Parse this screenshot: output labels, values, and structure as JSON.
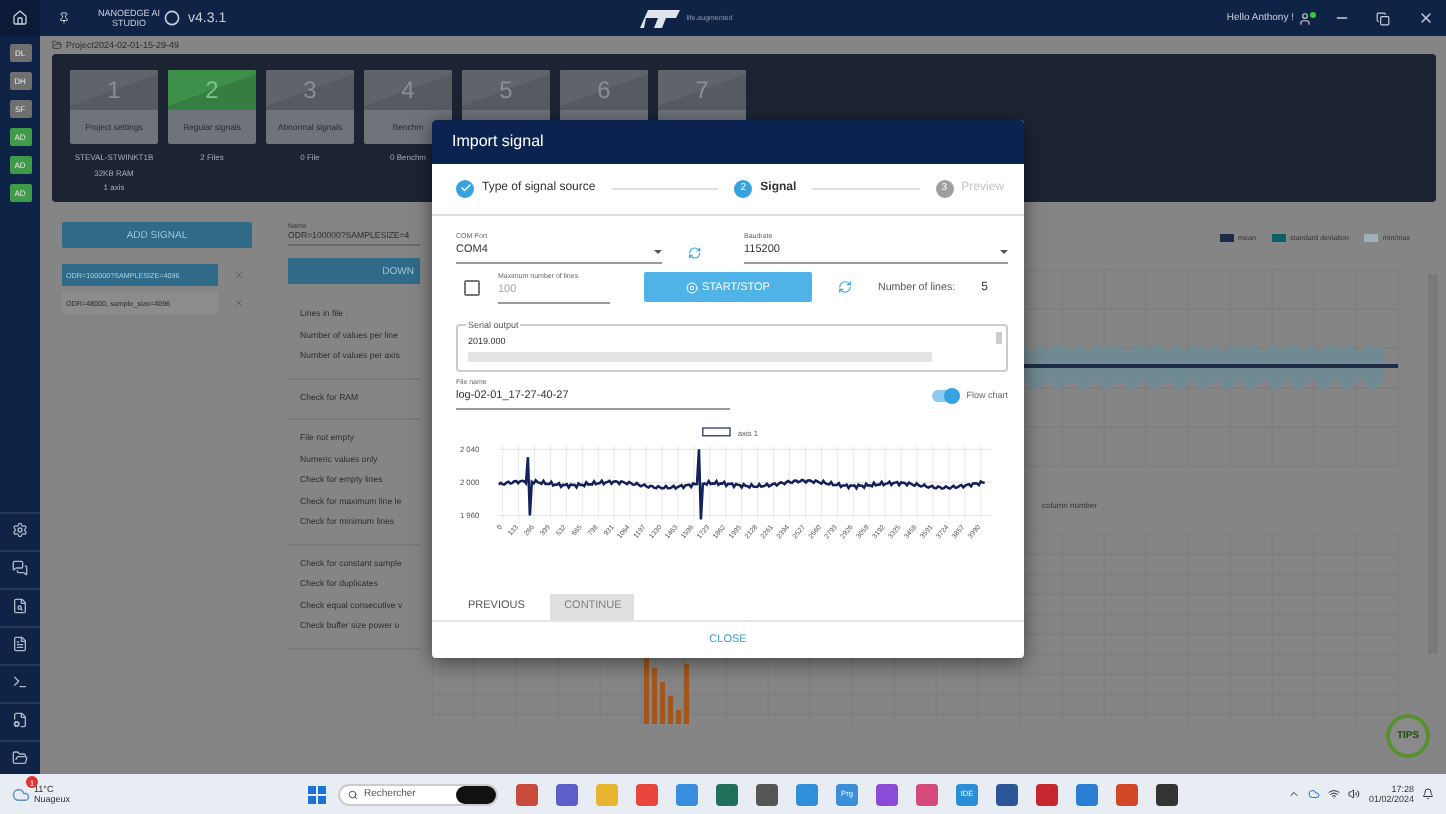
{
  "app": {
    "brand_line_1": "NANOEDGE AI",
    "brand_line_2": "STUDIO",
    "version": "v4.3.1",
    "logo_tagline": "life.augmented",
    "greeting": "Hello Anthony !",
    "user_online": true
  },
  "sidebar": {
    "items": [
      {
        "label": "DL",
        "color": "#6f6f6f"
      },
      {
        "label": "DH",
        "color": "#6f6f6f"
      },
      {
        "label": "SF",
        "color": "#6f6f6f"
      },
      {
        "label": "AD",
        "color": "#3f9a4a"
      },
      {
        "label": "AD",
        "color": "#3f9a4a"
      },
      {
        "label": "AD",
        "color": "#3f9a4a"
      }
    ]
  },
  "project": {
    "path": "Project2024-02-01-15-29-49",
    "steps": [
      {
        "number": "1",
        "label": "Project settings",
        "selected": false,
        "info": [
          "STEVAL-STWINKT1B",
          "32KB RAM",
          "1 axis"
        ]
      },
      {
        "number": "2",
        "label": "Regular signals",
        "selected": true,
        "info": [
          "2 Files"
        ]
      },
      {
        "number": "3",
        "label": "Abnormal signals",
        "selected": false,
        "info": [
          "0 File"
        ]
      },
      {
        "number": "4",
        "label": "Benchm",
        "selected": false,
        "info": [
          "0 Benchm"
        ]
      },
      {
        "number": "5",
        "selected": false
      },
      {
        "number": "6",
        "selected": false
      },
      {
        "number": "7",
        "selected": false
      }
    ]
  },
  "signals": {
    "add_button": "ADD SIGNAL",
    "items": [
      {
        "label": "ODR=100000?SAMPLESIZE=4096",
        "selected": true
      },
      {
        "label": "ODR=48000, sample_size=4096",
        "selected": false
      }
    ]
  },
  "details": {
    "name_label": "Name",
    "name_value": "ODR=100000?SAMPLESIZE=4",
    "download_button": "DOWN",
    "groups": [
      [
        "Lines in file :",
        "Number of values per line",
        "Number of values per axis"
      ],
      [
        "Check for RAM"
      ],
      [
        "File not empty",
        "Numeric values only",
        "Check for empty lines",
        "Check for maximum line le",
        "Check for minimum lines"
      ],
      [
        "Check for constant sample",
        "Check for duplicates",
        "Check equal consecutive v",
        "Check buffer size power o"
      ]
    ]
  },
  "chart": {
    "legend": [
      {
        "label": "mean",
        "color": "#1f2b45"
      },
      {
        "label": "standard deviation",
        "color": "#0c5f6b"
      },
      {
        "label": "min/max",
        "color": "#9fb2b8"
      }
    ],
    "xlabel": "column number"
  },
  "tips": "TIPS",
  "modal": {
    "title": "Import signal",
    "steps": [
      {
        "label": "Type of signal source",
        "done": true,
        "selected": false
      },
      {
        "number": "2",
        "label": "Signal",
        "done": false,
        "selected": true
      },
      {
        "number": "3",
        "label": "Preview",
        "done": false,
        "selected": false
      }
    ],
    "com_port": {
      "label": "COM Port",
      "value": "COM4"
    },
    "baudrate": {
      "label": "Baudrate",
      "value": "115200"
    },
    "max_lines": {
      "checked": false,
      "label": "Maximum number of lines",
      "value": "100",
      "disabled": true
    },
    "start_stop": "START/STOP",
    "lines_label": "Number of lines:",
    "lines_value": "5",
    "serial_output": {
      "legend": "Serial output",
      "text": "2019.000"
    },
    "file_name": {
      "label": "File name",
      "value": "log-02-01_17-27-40-27"
    },
    "flow_chart": {
      "label": "Flow chart",
      "on": true
    },
    "preview_chart": {
      "legend": "axis 1",
      "yticks": [
        "2 040",
        "2 000",
        "1 960"
      ],
      "xticks": [
        "0",
        "133",
        "266",
        "399",
        "532",
        "665",
        "798",
        "931",
        "1064",
        "1197",
        "1330",
        "1463",
        "1596",
        "1729",
        "1862",
        "1995",
        "2128",
        "2261",
        "2394",
        "2527",
        "2660",
        "2793",
        "2926",
        "3059",
        "3192",
        "3325",
        "3458",
        "3591",
        "3724",
        "3857",
        "3990"
      ]
    },
    "previous": "PREVIOUS",
    "continue": {
      "label": "CONTINUE",
      "disabled": true
    },
    "close": "CLOSE"
  },
  "taskbar": {
    "weather_badge": "1",
    "temperature": "11°C",
    "weather": "Nuageux",
    "search_placeholder": "Rechercher",
    "apps": [
      {
        "label": "Prg"
      },
      {
        "label": "IDE"
      }
    ],
    "time": "17:28",
    "date": "01/02/2024"
  }
}
